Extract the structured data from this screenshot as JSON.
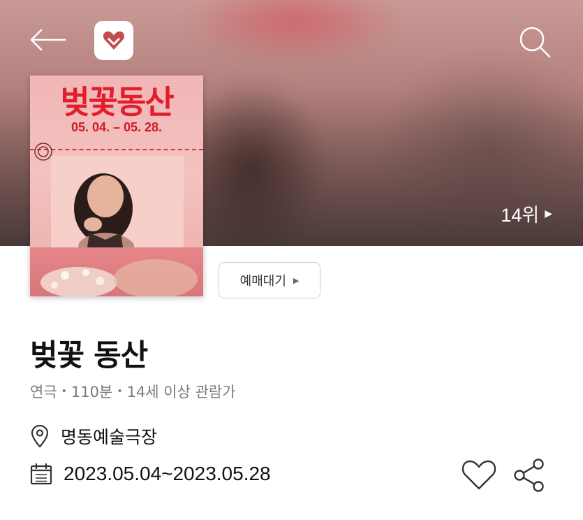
{
  "header": {
    "back_icon": "back-arrow-icon",
    "logo_icon": "heart-logo-icon",
    "search_icon": "search-icon",
    "rank_label": "14위"
  },
  "poster": {
    "title": "벚꽃동산",
    "dates": "05. 04. – 05. 28."
  },
  "actions": {
    "reserve_label": "예매대기"
  },
  "show": {
    "title": "벚꽃 동산",
    "genre": "연극",
    "runtime": "110분",
    "age": "14세 이상 관람가",
    "venue": "명동예술극장",
    "period": "2023.05.04~2023.05.28"
  },
  "colors": {
    "accent_red": "#e01e2e",
    "text_gray": "#7a7a7a",
    "text_dark": "#111111"
  }
}
